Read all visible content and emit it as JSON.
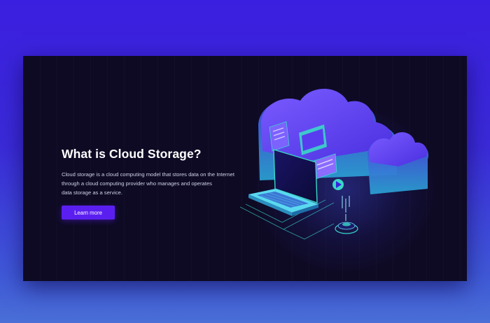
{
  "hero": {
    "title": "What is Cloud Storage?",
    "description_lines": [
      "Cloud storage is a cloud computing model that stores data on the Internet",
      "through a cloud computing provider who manages and operates",
      "data storage as a service."
    ],
    "cta_label": "Learn more"
  },
  "colors": {
    "page_background_top": "#3b1fe0",
    "card_background": "#0e0a24",
    "accent_button": "#5a1ff0",
    "cloud_purple": "#5a3cf0",
    "neon_cyan": "#36e0c8"
  },
  "icons": [
    "cloud-icon",
    "laptop-icon",
    "document-icon",
    "play-icon",
    "database-node-icon"
  ]
}
